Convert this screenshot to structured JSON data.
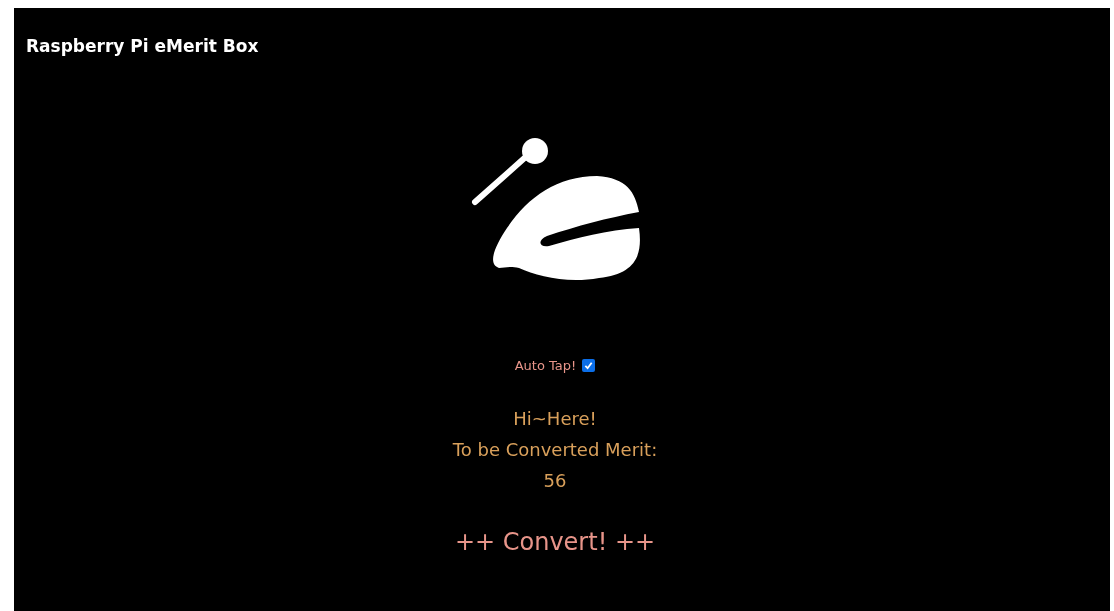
{
  "header": {
    "title": "Raspberry Pi eMerit Box"
  },
  "auto_tap": {
    "label": "Auto Tap!",
    "checked": true
  },
  "greeting": "Hi~Here!",
  "merit": {
    "label": "To be Converted Merit:",
    "value": "56"
  },
  "convert_button": {
    "label": "++ Convert! ++"
  }
}
